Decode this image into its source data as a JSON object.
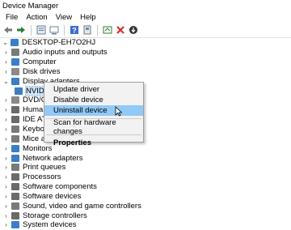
{
  "window": {
    "title": "Device Manager"
  },
  "menubar": [
    "File",
    "Action",
    "View",
    "Help"
  ],
  "toolbar": {
    "icons": [
      "back-arrow-icon",
      "forward-arrow-icon",
      "properties-icon",
      "computer-icon",
      "help-icon",
      "update-driver-icon",
      "scan-hardware-icon",
      "uninstall-x-icon",
      "download-icon"
    ]
  },
  "tree": {
    "root": "DESKTOP-EH7O2HJ",
    "items": [
      {
        "label": "Audio inputs and outputs",
        "icon": "speaker-icon",
        "color": "#7a7a7a"
      },
      {
        "label": "Computer",
        "icon": "monitor-icon",
        "color": "#3a7ec8"
      },
      {
        "label": "Disk drives",
        "icon": "disk-icon",
        "color": "#8a8a8a"
      },
      {
        "label": "Display adapters",
        "icon": "display-adapter-icon",
        "color": "#3a7ec8",
        "expanded": true
      },
      {
        "label": "NVIDIA GeForce GT 1030",
        "icon": "display-adapter-icon",
        "color": "#3a7ec8",
        "child": true
      },
      {
        "label": "DVD/CD-ROM drives",
        "icon": "dvd-icon",
        "color": "#8a8a8a"
      },
      {
        "label": "Human Interface Devices",
        "icon": "hid-icon",
        "color": "#6a6a6a"
      },
      {
        "label": "IDE ATA/ATAPI controllers",
        "icon": "ide-icon",
        "color": "#6a6a6a"
      },
      {
        "label": "Keyboards",
        "icon": "keyboard-icon",
        "color": "#7a7a7a"
      },
      {
        "label": "Mice and other pointing devices",
        "icon": "mouse-icon",
        "color": "#7a7a7a"
      },
      {
        "label": "Monitors",
        "icon": "monitor-icon",
        "color": "#3a7ec8"
      },
      {
        "label": "Network adapters",
        "icon": "network-icon",
        "color": "#3a7ec8"
      },
      {
        "label": "Print queues",
        "icon": "printer-icon",
        "color": "#7a7a7a"
      },
      {
        "label": "Processors",
        "icon": "processor-icon",
        "color": "#6a6a6a"
      },
      {
        "label": "Software components",
        "icon": "software-icon",
        "color": "#6a6a6a"
      },
      {
        "label": "Software devices",
        "icon": "software-icon",
        "color": "#6a6a6a"
      },
      {
        "label": "Sound, video and game controllers",
        "icon": "speaker-icon",
        "color": "#7a7a7a"
      },
      {
        "label": "Storage controllers",
        "icon": "storage-icon",
        "color": "#6a6a6a"
      },
      {
        "label": "System devices",
        "icon": "system-icon",
        "color": "#3a7ec8"
      }
    ]
  },
  "context_menu": {
    "update_driver": "Update driver",
    "disable_device": "Disable device",
    "uninstall_device": "Uninstall device",
    "scan": "Scan for hardware changes",
    "properties": "Properties"
  }
}
